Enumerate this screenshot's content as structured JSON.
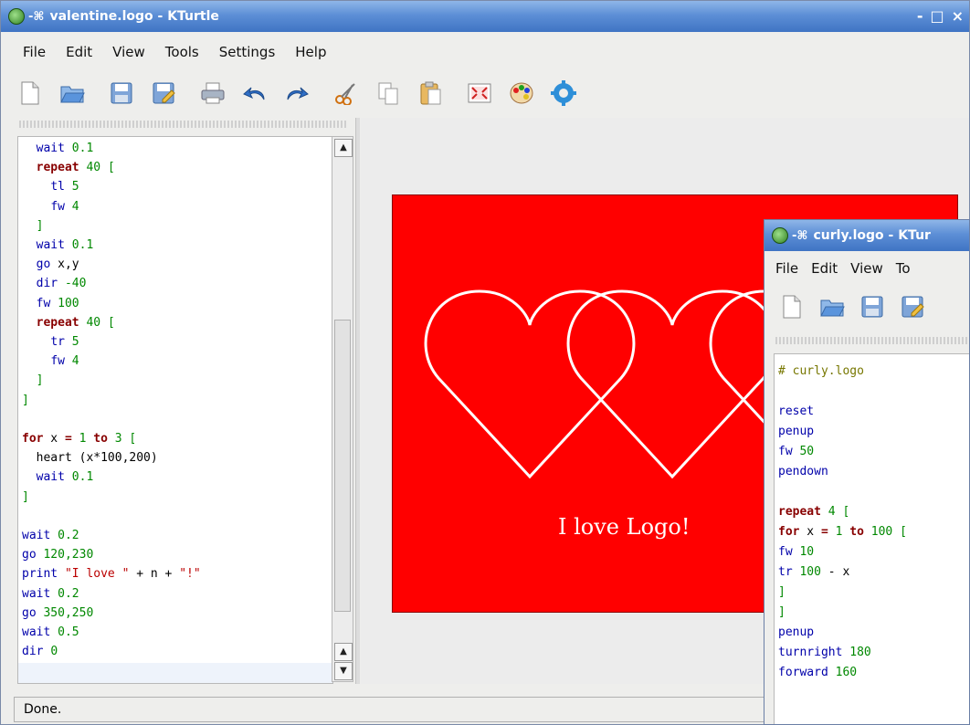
{
  "main_window": {
    "title": "valentine.logo - KTurtle",
    "window_buttons": [
      "-",
      "□",
      "×"
    ],
    "menu": [
      "File",
      "Edit",
      "View",
      "Tools",
      "Settings",
      "Help"
    ],
    "toolbar_icons": [
      "new-file-icon",
      "open-folder-icon",
      "save-icon",
      "save-as-icon",
      "print-icon",
      "undo-icon",
      "redo-icon",
      "cut-icon",
      "copy-icon",
      "paste-icon",
      "fullscreen-icon",
      "color-picker-icon",
      "settings-icon"
    ],
    "code_lines": [
      [
        [
          "",
          "  "
        ],
        [
          "fn",
          "wait"
        ],
        [
          "",
          " "
        ],
        [
          "num",
          "0.1"
        ]
      ],
      [
        [
          "",
          "  "
        ],
        [
          "kw",
          "repeat"
        ],
        [
          "",
          " "
        ],
        [
          "num",
          "40"
        ],
        [
          "",
          " "
        ],
        [
          "br",
          "["
        ]
      ],
      [
        [
          "",
          "    "
        ],
        [
          "fn",
          "tl"
        ],
        [
          "",
          " "
        ],
        [
          "num",
          "5"
        ]
      ],
      [
        [
          "",
          "    "
        ],
        [
          "fn",
          "fw"
        ],
        [
          "",
          " "
        ],
        [
          "num",
          "4"
        ]
      ],
      [
        [
          "",
          "  "
        ],
        [
          "br",
          "]"
        ]
      ],
      [
        [
          "",
          "  "
        ],
        [
          "fn",
          "wait"
        ],
        [
          "",
          " "
        ],
        [
          "num",
          "0.1"
        ]
      ],
      [
        [
          "",
          "  "
        ],
        [
          "fn",
          "go"
        ],
        [
          "",
          " x,y"
        ]
      ],
      [
        [
          "",
          "  "
        ],
        [
          "fn",
          "dir"
        ],
        [
          "",
          " "
        ],
        [
          "num",
          "-40"
        ]
      ],
      [
        [
          "",
          "  "
        ],
        [
          "fn",
          "fw"
        ],
        [
          "",
          " "
        ],
        [
          "num",
          "100"
        ]
      ],
      [
        [
          "",
          "  "
        ],
        [
          "kw",
          "repeat"
        ],
        [
          "",
          " "
        ],
        [
          "num",
          "40"
        ],
        [
          "",
          " "
        ],
        [
          "br",
          "["
        ]
      ],
      [
        [
          "",
          "    "
        ],
        [
          "fn",
          "tr"
        ],
        [
          "",
          " "
        ],
        [
          "num",
          "5"
        ]
      ],
      [
        [
          "",
          "    "
        ],
        [
          "fn",
          "fw"
        ],
        [
          "",
          " "
        ],
        [
          "num",
          "4"
        ]
      ],
      [
        [
          "",
          "  "
        ],
        [
          "br",
          "]"
        ]
      ],
      [
        [
          "br",
          "]"
        ]
      ],
      [
        [
          "",
          ""
        ]
      ],
      [
        [
          "kw",
          "for"
        ],
        [
          "",
          " x "
        ],
        [
          "kw",
          "="
        ],
        [
          "",
          " "
        ],
        [
          "num",
          "1"
        ],
        [
          "",
          " "
        ],
        [
          "kw",
          "to"
        ],
        [
          "",
          " "
        ],
        [
          "num",
          "3"
        ],
        [
          "",
          " "
        ],
        [
          "br",
          "["
        ]
      ],
      [
        [
          "",
          "  heart (x*100,200)"
        ]
      ],
      [
        [
          "",
          "  "
        ],
        [
          "fn",
          "wait"
        ],
        [
          "",
          " "
        ],
        [
          "num",
          "0.1"
        ]
      ],
      [
        [
          "br",
          "]"
        ]
      ],
      [
        [
          "",
          ""
        ]
      ],
      [
        [
          "fn",
          "wait"
        ],
        [
          "",
          " "
        ],
        [
          "num",
          "0.2"
        ]
      ],
      [
        [
          "fn",
          "go"
        ],
        [
          "",
          " "
        ],
        [
          "num",
          "120,230"
        ]
      ],
      [
        [
          "fn",
          "print"
        ],
        [
          "",
          " "
        ],
        [
          "str",
          "\"I love \""
        ],
        [
          "",
          " + n + "
        ],
        [
          "str",
          "\"!\""
        ]
      ],
      [
        [
          "fn",
          "wait"
        ],
        [
          "",
          " "
        ],
        [
          "num",
          "0.2"
        ]
      ],
      [
        [
          "fn",
          "go"
        ],
        [
          "",
          " "
        ],
        [
          "num",
          "350,250"
        ]
      ],
      [
        [
          "fn",
          "wait"
        ],
        [
          "",
          " "
        ],
        [
          "num",
          "0.5"
        ]
      ],
      [
        [
          "fn",
          "dir"
        ],
        [
          "",
          " "
        ],
        [
          "num",
          "0"
        ]
      ]
    ],
    "canvas_text": "I love Logo!",
    "canvas_color": "#ff0000",
    "status": "Done."
  },
  "second_window": {
    "title": "curly.logo - KTur",
    "menu": [
      "File",
      "Edit",
      "View",
      "To"
    ],
    "toolbar_icons": [
      "new-file-icon",
      "open-folder-icon",
      "save-icon",
      "save-as-icon"
    ],
    "code_lines": [
      [
        [
          "cmt",
          "# curly.logo"
        ]
      ],
      [
        [
          "",
          ""
        ]
      ],
      [
        [
          "fn",
          "reset"
        ]
      ],
      [
        [
          "fn",
          "penup"
        ]
      ],
      [
        [
          "fn",
          "fw"
        ],
        [
          "",
          " "
        ],
        [
          "num",
          "50"
        ]
      ],
      [
        [
          "fn",
          "pendown"
        ]
      ],
      [
        [
          "",
          ""
        ]
      ],
      [
        [
          "kw",
          "repeat"
        ],
        [
          "",
          " "
        ],
        [
          "num",
          "4"
        ],
        [
          "",
          " "
        ],
        [
          "br",
          "["
        ]
      ],
      [
        [
          "kw",
          "for"
        ],
        [
          "",
          " x "
        ],
        [
          "kw",
          "="
        ],
        [
          "",
          " "
        ],
        [
          "num",
          "1"
        ],
        [
          "",
          " "
        ],
        [
          "kw",
          "to"
        ],
        [
          "",
          " "
        ],
        [
          "num",
          "100"
        ],
        [
          "",
          " "
        ],
        [
          "br",
          "["
        ]
      ],
      [
        [
          "fn",
          "fw"
        ],
        [
          "",
          " "
        ],
        [
          "num",
          "10"
        ]
      ],
      [
        [
          "fn",
          "tr"
        ],
        [
          "",
          " "
        ],
        [
          "num",
          "100"
        ],
        [
          "",
          " - x"
        ]
      ],
      [
        [
          "br",
          "]"
        ]
      ],
      [
        [
          "br",
          "]"
        ]
      ],
      [
        [
          "fn",
          "penup"
        ]
      ],
      [
        [
          "fn",
          "turnright"
        ],
        [
          "",
          " "
        ],
        [
          "num",
          "180"
        ]
      ],
      [
        [
          "fn",
          "forward"
        ],
        [
          "",
          " "
        ],
        [
          "num",
          "160"
        ]
      ]
    ]
  }
}
